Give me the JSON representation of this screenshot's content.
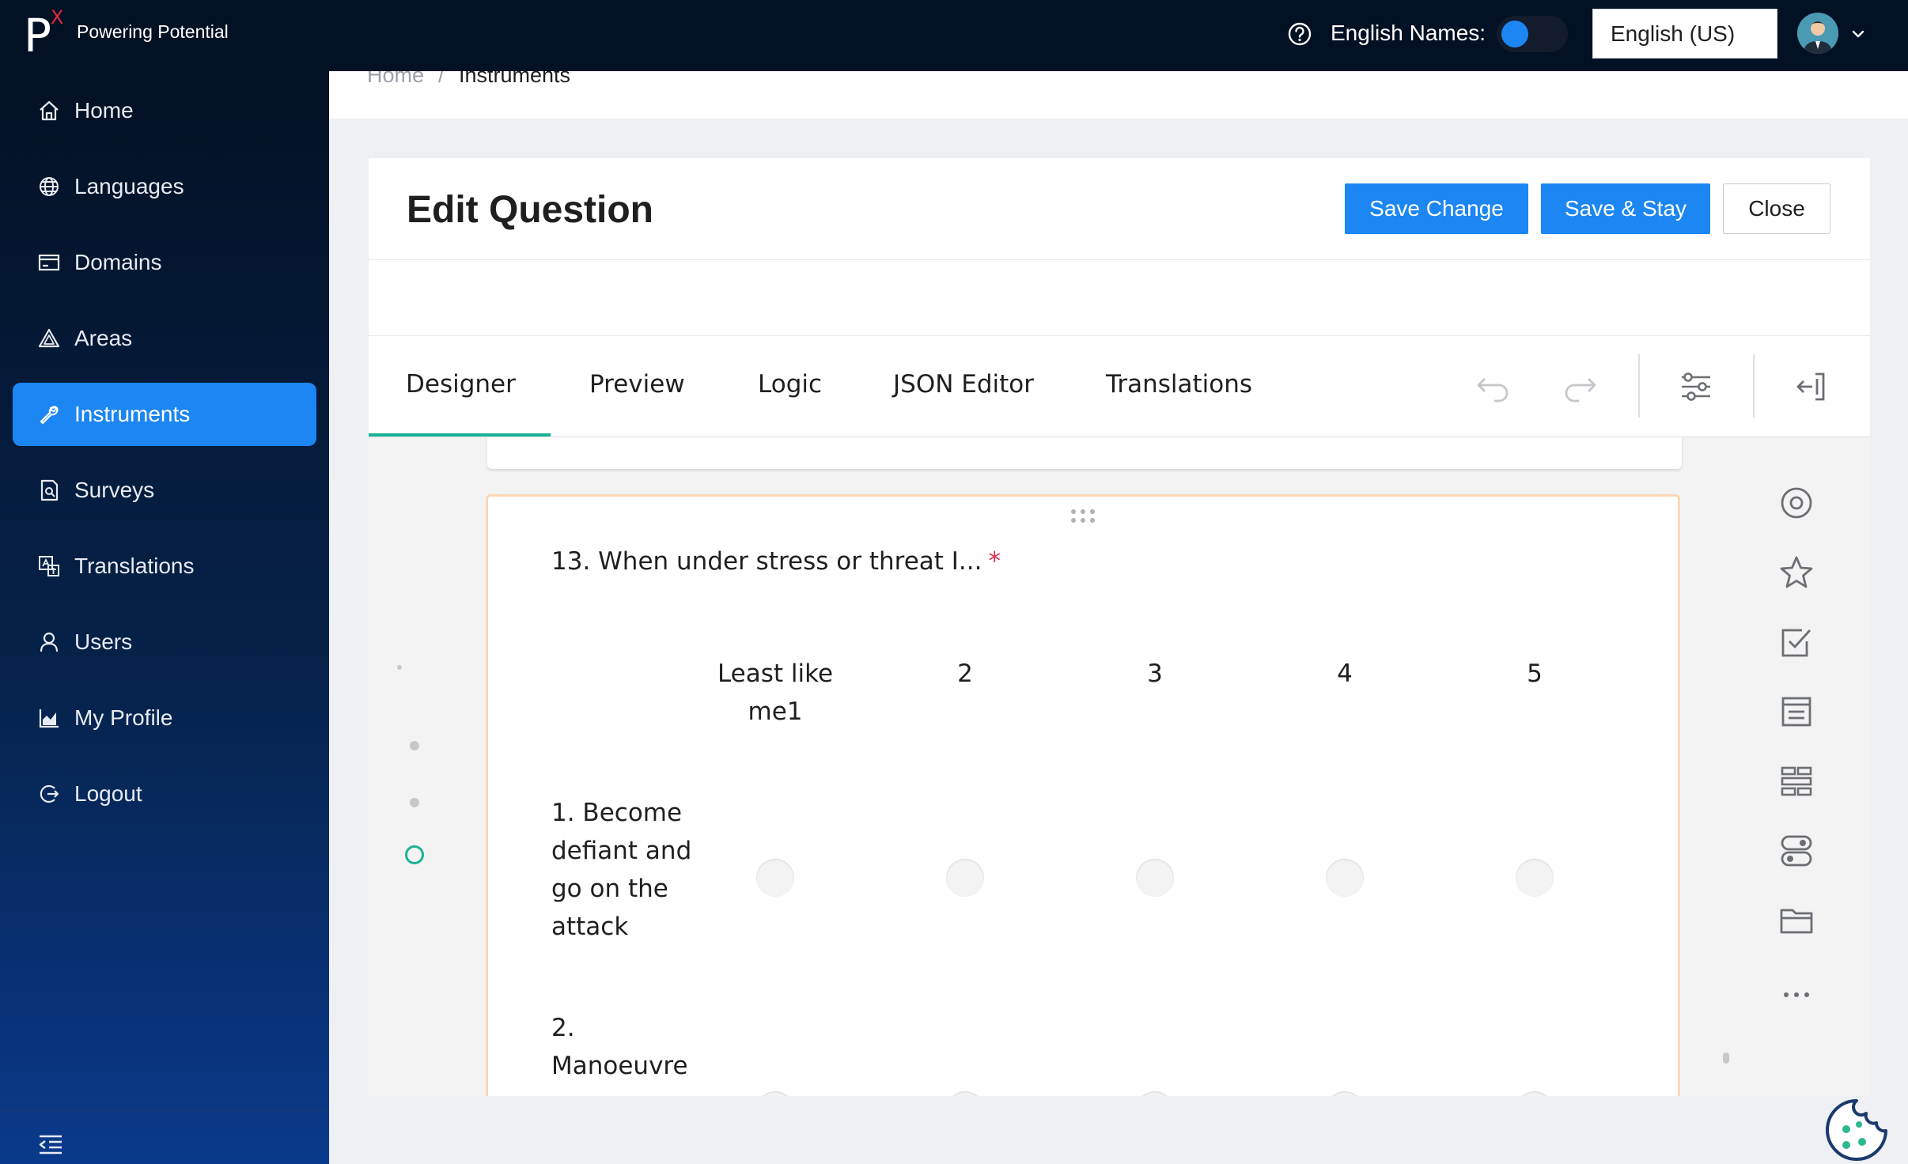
{
  "topbar": {
    "logo_letter": "P",
    "logo_superscript": "X",
    "tagline": "Powering Potential",
    "english_names_label": "English Names:",
    "english_names_enabled": true,
    "language": "English (US)"
  },
  "sidebar": {
    "items": [
      {
        "label": "Home",
        "icon": "home-icon"
      },
      {
        "label": "Languages",
        "icon": "globe-icon"
      },
      {
        "label": "Domains",
        "icon": "folder-card-icon"
      },
      {
        "label": "Areas",
        "icon": "triangle-icon"
      },
      {
        "label": "Instruments",
        "icon": "wrench-icon",
        "active": true
      },
      {
        "label": "Surveys",
        "icon": "survey-doc-icon"
      },
      {
        "label": "Translations",
        "icon": "translate-icon"
      },
      {
        "label": "Users",
        "icon": "user-icon"
      },
      {
        "label": "My Profile",
        "icon": "chart-icon"
      },
      {
        "label": "Logout",
        "icon": "logout-icon"
      }
    ]
  },
  "breadcrumb": {
    "home": "Home",
    "separator": "/",
    "current": "Instruments"
  },
  "card": {
    "title": "Edit Question",
    "save_change": "Save Change",
    "save_stay": "Save & Stay",
    "close": "Close"
  },
  "tabs": [
    {
      "label": "Designer",
      "active": true
    },
    {
      "label": "Preview"
    },
    {
      "label": "Logic"
    },
    {
      "label": "JSON Editor"
    },
    {
      "label": "Translations"
    }
  ],
  "question": {
    "title": "13. When under stress or threat I...",
    "required_mark": "*",
    "columns": [
      "Least like me1",
      "2",
      "3",
      "4",
      "5"
    ],
    "rows": [
      "1. Become defiant and go on the attack",
      "2. Manoeuvre"
    ]
  },
  "colors": {
    "accent": "#1c86f2",
    "designer_accent": "#19b394",
    "topbar_bg": "#031124",
    "required": "#e0294a",
    "selected_border": "#fbd7b6"
  }
}
